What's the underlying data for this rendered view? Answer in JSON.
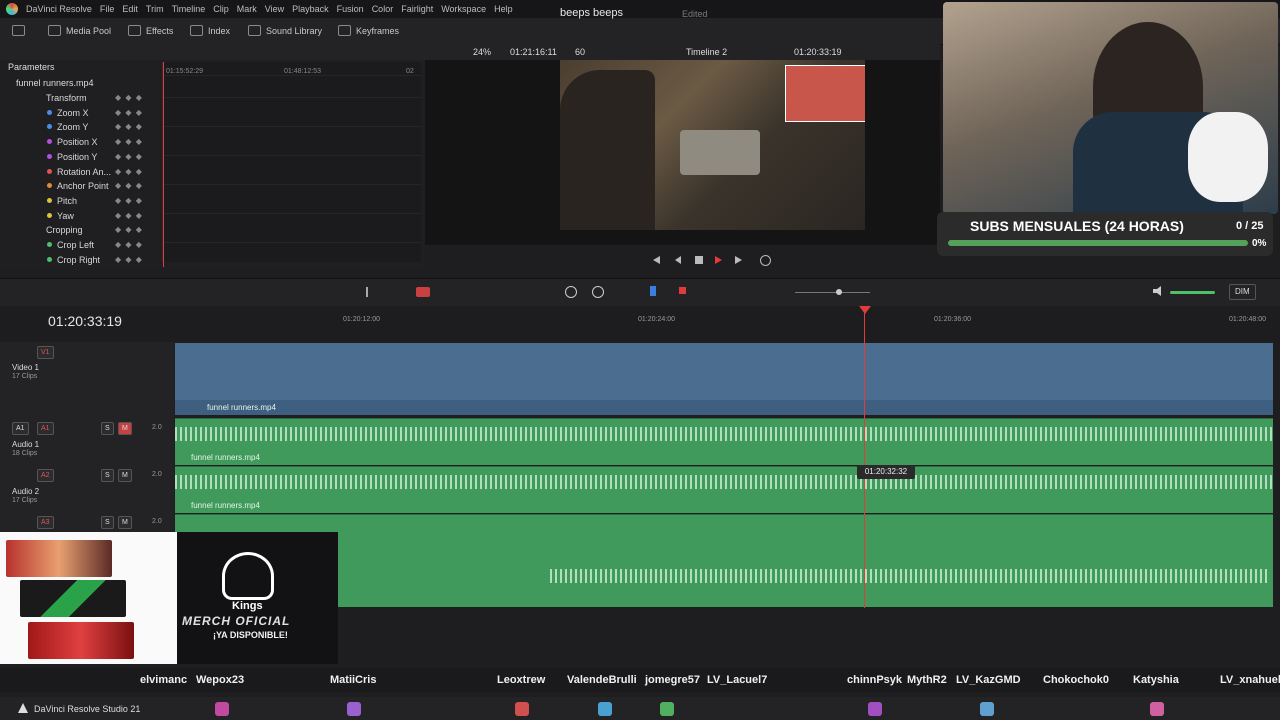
{
  "menubar": {
    "app": "DaVinci Resolve",
    "items": [
      "File",
      "Edit",
      "Trim",
      "Timeline",
      "Clip",
      "Mark",
      "View",
      "Playback",
      "Fusion",
      "Color",
      "Fairlight",
      "Workspace",
      "Help"
    ]
  },
  "toolbar": {
    "media_pool": "Media Pool",
    "effects": "Effects",
    "index": "Index",
    "sound_library": "Sound Library",
    "keyframes": "Keyframes"
  },
  "project": {
    "title": "beeps beeps",
    "status": "Edited"
  },
  "viewer_bar": {
    "zoom": "24%",
    "source_tc": "01:21:16:11",
    "fps": "60",
    "timeline": "Timeline 2",
    "record_tc": "01:20:33:19"
  },
  "keyframes": {
    "panel_title": "Parameters",
    "clip_name": "funnel runners.mp4",
    "ruler": [
      "01:15:52:29",
      "01:48:12:53",
      "02"
    ],
    "rows": [
      {
        "label": "Transform",
        "type": "group"
      },
      {
        "label": "Zoom X",
        "color": "#4a8ee8"
      },
      {
        "label": "Zoom Y",
        "color": "#4a8ee8"
      },
      {
        "label": "Position X",
        "color": "#b44fe0"
      },
      {
        "label": "Position Y",
        "color": "#b44fe0"
      },
      {
        "label": "Rotation An...",
        "color": "#e05454"
      },
      {
        "label": "Anchor Point",
        "color": "#e08a3a"
      },
      {
        "label": "Pitch",
        "color": "#e0c23a"
      },
      {
        "label": "Yaw",
        "color": "#e0c23a"
      },
      {
        "label": "Cropping",
        "type": "group"
      },
      {
        "label": "Crop Left",
        "color": "#4ec06a"
      },
      {
        "label": "Crop Right",
        "color": "#4ec06a"
      }
    ]
  },
  "timeline": {
    "timecode": "01:20:33:19",
    "ruler": [
      "01:20:12:00",
      "01:20:24:00",
      "01:20:36:00",
      "01:20:48:00"
    ],
    "hover_tc": "01:20:32:32",
    "dim_label": "DIM",
    "tracks": {
      "v1": {
        "badge": "V1",
        "name": "Video 1",
        "clips": "17 Clips",
        "clip": "funnel runners.mp4"
      },
      "a1": {
        "badge": "A1",
        "name": "Audio 1",
        "clips": "18 Clips",
        "clip": "funnel runners.mp4",
        "level": "2.0",
        "solo": "S",
        "mute": "M"
      },
      "a2": {
        "badge": "A2",
        "name": "Audio 2",
        "clips": "17 Clips",
        "clip": "funnel runners.mp4",
        "level": "2.0",
        "solo": "S",
        "mute": "M"
      },
      "a3": {
        "badge": "A3",
        "level": "2.0",
        "solo": "S",
        "mute": "M"
      }
    }
  },
  "stream": {
    "subs_title": "SUBS MENSUALES (24 HORAS)",
    "subs_count": "0 / 25",
    "subs_pct": "0%",
    "subs_progress": 0,
    "merch_brand": "Kings",
    "merch_title": "MERCH OFICIAL",
    "merch_sub": "¡YA DISPONIBLE!",
    "viewers": [
      "elvimanc",
      "Wepox23",
      "MatiiCris",
      "Leoxtrew",
      "ValendeBrulli",
      "jomegre57",
      "LV_Lacuel7",
      "chinnPsyk",
      "MythR2",
      "LV_KazGMD",
      "Chokochok0",
      "Katyshia",
      "LV_xnahuel"
    ]
  },
  "taskbar": {
    "app": "DaVinci Resolve Studio 21"
  },
  "colors": {
    "accent": "#e23b3b",
    "video_clip": "#4b6d8f",
    "audio_clip": "#3f9a5c"
  }
}
